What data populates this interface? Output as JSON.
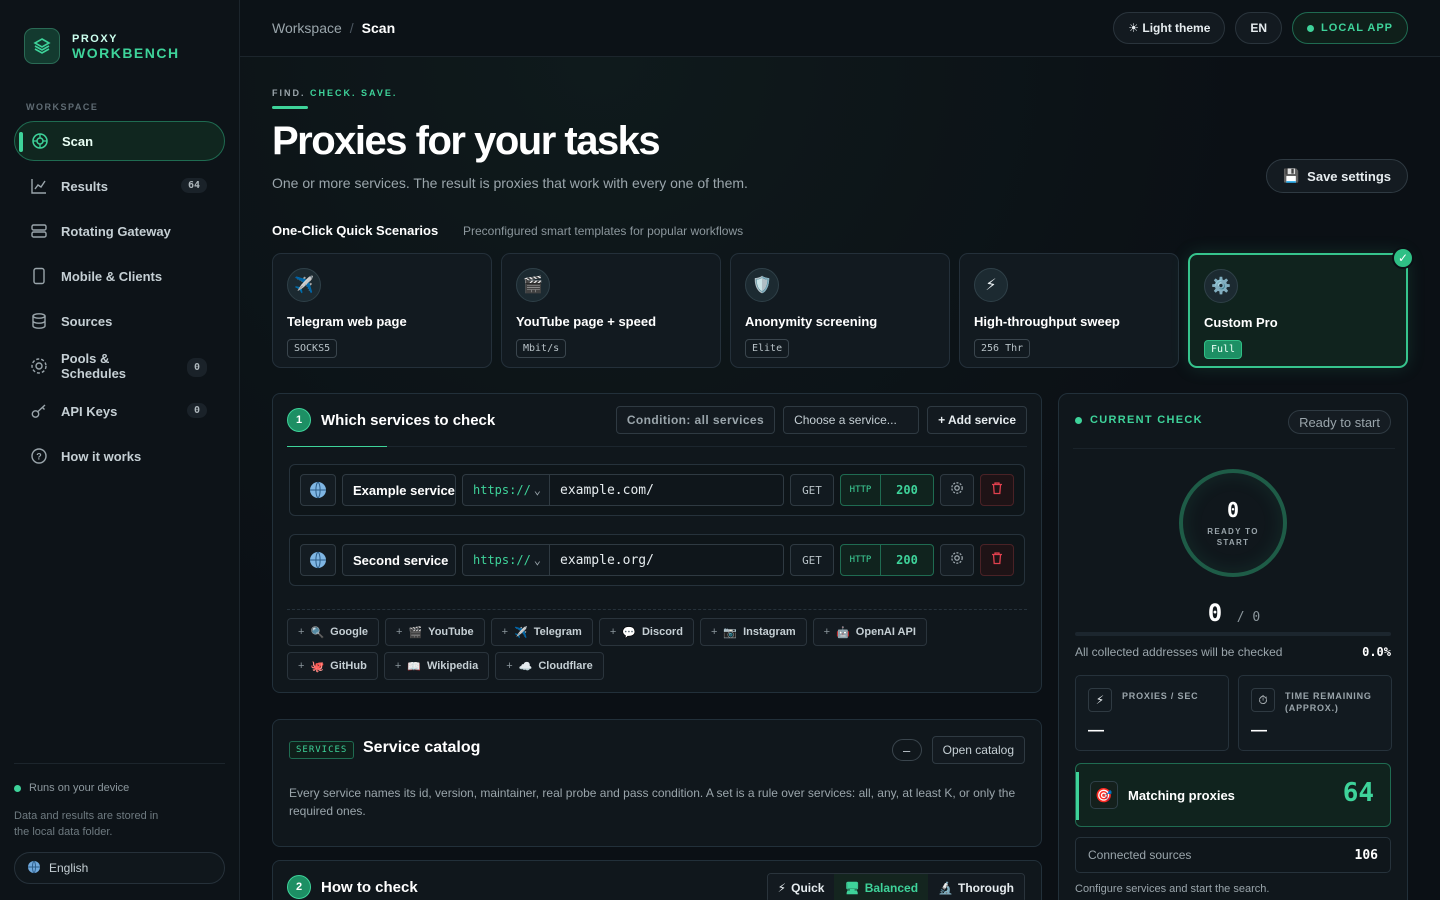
{
  "brand": {
    "sub": "PROXY",
    "main": "WORKBENCH"
  },
  "sidebar": {
    "section_label": "WORKSPACE",
    "items": [
      {
        "label": "Scan",
        "icon": "scan-icon",
        "count": ""
      },
      {
        "label": "Results",
        "icon": "chart-icon",
        "count": "64"
      },
      {
        "label": "Rotating Gateway",
        "icon": "server-icon",
        "count": ""
      },
      {
        "label": "Mobile & Clients",
        "icon": "phone-icon",
        "count": ""
      },
      {
        "label": "Sources",
        "icon": "database-icon",
        "count": ""
      },
      {
        "label": "Pools &\nSchedules",
        "icon": "pools-icon",
        "count": "0"
      },
      {
        "label": "API Keys",
        "icon": "key-icon",
        "count": "0"
      },
      {
        "label": "How it works",
        "icon": "help-icon",
        "count": ""
      }
    ],
    "runs_note": "Runs on your device",
    "storage_note": "Data and results are stored in the local data folder.",
    "language": "English"
  },
  "topbar": {
    "breadcrumb_root": "Workspace",
    "breadcrumb_current": "Scan",
    "theme_label": "☀ Light theme",
    "lang_label": "EN",
    "local_label": "LOCAL APP"
  },
  "hero": {
    "kicker_a": "FIND.",
    "kicker_b": "CHECK. SAVE.",
    "title": "Proxies for your tasks",
    "lead": "One or more services. The result is proxies that work with every one of them.",
    "save_label": "Save settings"
  },
  "quick": {
    "title": "One-Click Quick Scenarios",
    "subtitle": "Preconfigured smart templates for popular workflows",
    "cards": [
      {
        "icon": "✈️",
        "title": "Telegram web page",
        "tag": "SOCKS5"
      },
      {
        "icon": "🎬",
        "title": "YouTube page + speed",
        "tag": "Mbit/s"
      },
      {
        "icon": "🛡️",
        "title": "Anonymity screening",
        "tag": "Elite"
      },
      {
        "icon": "⚡",
        "title": "High-throughput sweep",
        "tag": "256 Thr"
      },
      {
        "icon": "⚙️",
        "title": "Custom Pro",
        "tag": "Full"
      }
    ]
  },
  "services": {
    "step": "1",
    "title": "Which services to check",
    "condition": "Condition: all services",
    "choose": "Choose a service...",
    "add": "+ Add service",
    "rows": [
      {
        "name": "Example service",
        "proto": "https://",
        "url": "example.com/",
        "method": "GET",
        "http": "HTTP",
        "code": "200"
      },
      {
        "name": "Second service",
        "proto": "https://",
        "url": "example.org/",
        "method": "GET",
        "http": "HTTP",
        "code": "200"
      }
    ],
    "chips": [
      {
        "icon": "🔍",
        "label": "Google"
      },
      {
        "icon": "🎬",
        "label": "YouTube"
      },
      {
        "icon": "✈️",
        "label": "Telegram"
      },
      {
        "icon": "💬",
        "label": "Discord"
      },
      {
        "icon": "📷",
        "label": "Instagram"
      },
      {
        "icon": "🤖",
        "label": "OpenAI API"
      },
      {
        "icon": "🐙",
        "label": "GitHub"
      },
      {
        "icon": "📖",
        "label": "Wikipedia"
      },
      {
        "icon": "☁️",
        "label": "Cloudflare"
      }
    ]
  },
  "catalog": {
    "tag": "SERVICES",
    "title": "Service catalog",
    "open": "Open catalog",
    "description": "Every service names its id, version, maintainer, real probe and pass condition. A set is a rule over services: all, any, at least K, or only the required ones."
  },
  "how": {
    "step": "2",
    "title": "How to check",
    "modes": [
      {
        "icon": "⚡",
        "label": "Quick"
      },
      {
        "icon": "🖥",
        "label": "Balanced"
      },
      {
        "icon": "🔬",
        "label": "Thorough"
      }
    ]
  },
  "check": {
    "title": "CURRENT CHECK",
    "status": "Ready to start",
    "ring_value": "0",
    "ring_label": "READY TO START",
    "done": "0",
    "total": "0",
    "progress_fraction": 0,
    "progress_text": "All collected addresses will be checked",
    "progress_pct": "0.0%",
    "proxies_sec_label": "PROXIES / SEC",
    "proxies_sec_value": "—",
    "time_label": "TIME REMAINING (APPROX.)",
    "time_value": "—",
    "matching_label": "Matching proxies",
    "matching_value": "64",
    "sources_label": "Connected sources",
    "sources_value": "106",
    "configure_note": "Configure services and start the search."
  },
  "colors": {
    "accent": "#3ed39a",
    "bg": "#0b1015",
    "danger": "#e0404e"
  }
}
